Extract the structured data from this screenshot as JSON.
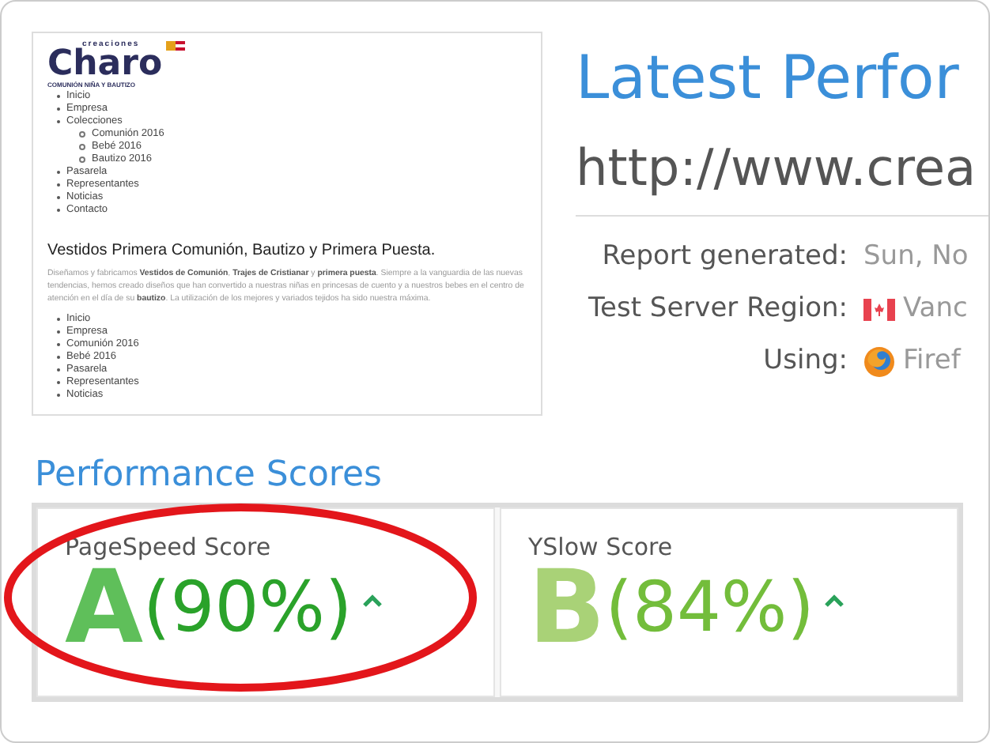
{
  "thumbnail": {
    "logo": {
      "name": "Charo",
      "overline": "creaciones",
      "tagline": "COMUNIÓN NIÑA Y BAUTIZO"
    },
    "menu": [
      {
        "label": "Inicio"
      },
      {
        "label": "Empresa"
      },
      {
        "label": "Colecciones",
        "children": [
          {
            "label": "Comunión 2016"
          },
          {
            "label": "Bebé 2016"
          },
          {
            "label": "Bautizo 2016"
          }
        ]
      },
      {
        "label": "Pasarela"
      },
      {
        "label": "Representantes"
      },
      {
        "label": "Noticias"
      },
      {
        "label": "Contacto"
      }
    ],
    "heading": "Vestidos Primera Comunión, Bautizo y Primera Puesta.",
    "paragraph": "Diseñamos y fabricamos **Vestidos de Comunión**, **Trajes de Cristianar** y **primera puesta**. Siempre a la vanguardia de las nuevas tendencias, hemos creado diseños que han convertido a nuestras niñas en princesas de cuento y a nuestros bebes en el centro de atención en el día de su **bautizo**. La utilización de los mejores y variados tejidos ha sido nuestra máxima.",
    "menu_2": [
      "Inicio",
      "Empresa",
      "Comunión 2016",
      "Bebé 2016",
      "Pasarela",
      "Representantes",
      "Noticias"
    ]
  },
  "title": "Latest Perfor",
  "url": "http://www.crea",
  "details": [
    {
      "label": "Report generated:",
      "value": "Sun, No",
      "kind": "plain"
    },
    {
      "label": "Test Server Region:",
      "value": "Vanc",
      "kind": "region"
    },
    {
      "label": "Using:",
      "value": "Firef",
      "kind": "browser"
    }
  ],
  "section_title": "Performance Scores",
  "scores": [
    {
      "label": "PageSpeed Score",
      "grade": "A",
      "percent": "(90%)",
      "annotated": true
    },
    {
      "label": "YSlow Score",
      "grade": "B",
      "percent": "(84%)",
      "annotated": false
    }
  ]
}
